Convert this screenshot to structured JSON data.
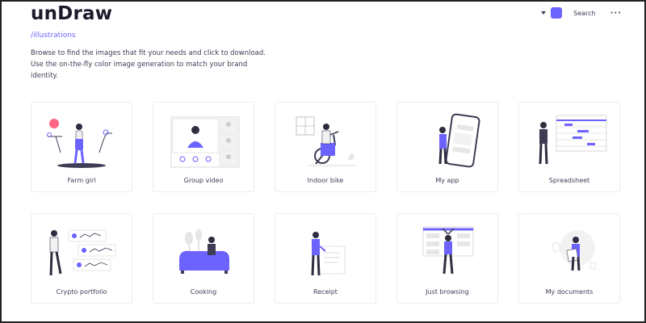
{
  "brand": {
    "logo": "unDraw",
    "route": "/illustrations",
    "accent": "#6c63ff"
  },
  "intro": "Browse to find the images that fit your needs and click to download. Use the on-the-fly color image generation to match your brand identity.",
  "header": {
    "search_label": "Search",
    "more_label": "···"
  },
  "cards": [
    {
      "label": "Farm girl",
      "icon": "farm-girl-illustration"
    },
    {
      "label": "Group video",
      "icon": "group-video-illustration"
    },
    {
      "label": "Indoor bike",
      "icon": "indoor-bike-illustration"
    },
    {
      "label": "My app",
      "icon": "my-app-illustration"
    },
    {
      "label": "Spreadsheet",
      "icon": "spreadsheet-illustration"
    },
    {
      "label": "Crypto portfolio",
      "icon": "crypto-portfolio-illustration"
    },
    {
      "label": "Cooking",
      "icon": "cooking-illustration"
    },
    {
      "label": "Receipt",
      "icon": "receipt-illustration"
    },
    {
      "label": "Just browsing",
      "icon": "just-browsing-illustration"
    },
    {
      "label": "My documents",
      "icon": "my-documents-illustration"
    }
  ]
}
